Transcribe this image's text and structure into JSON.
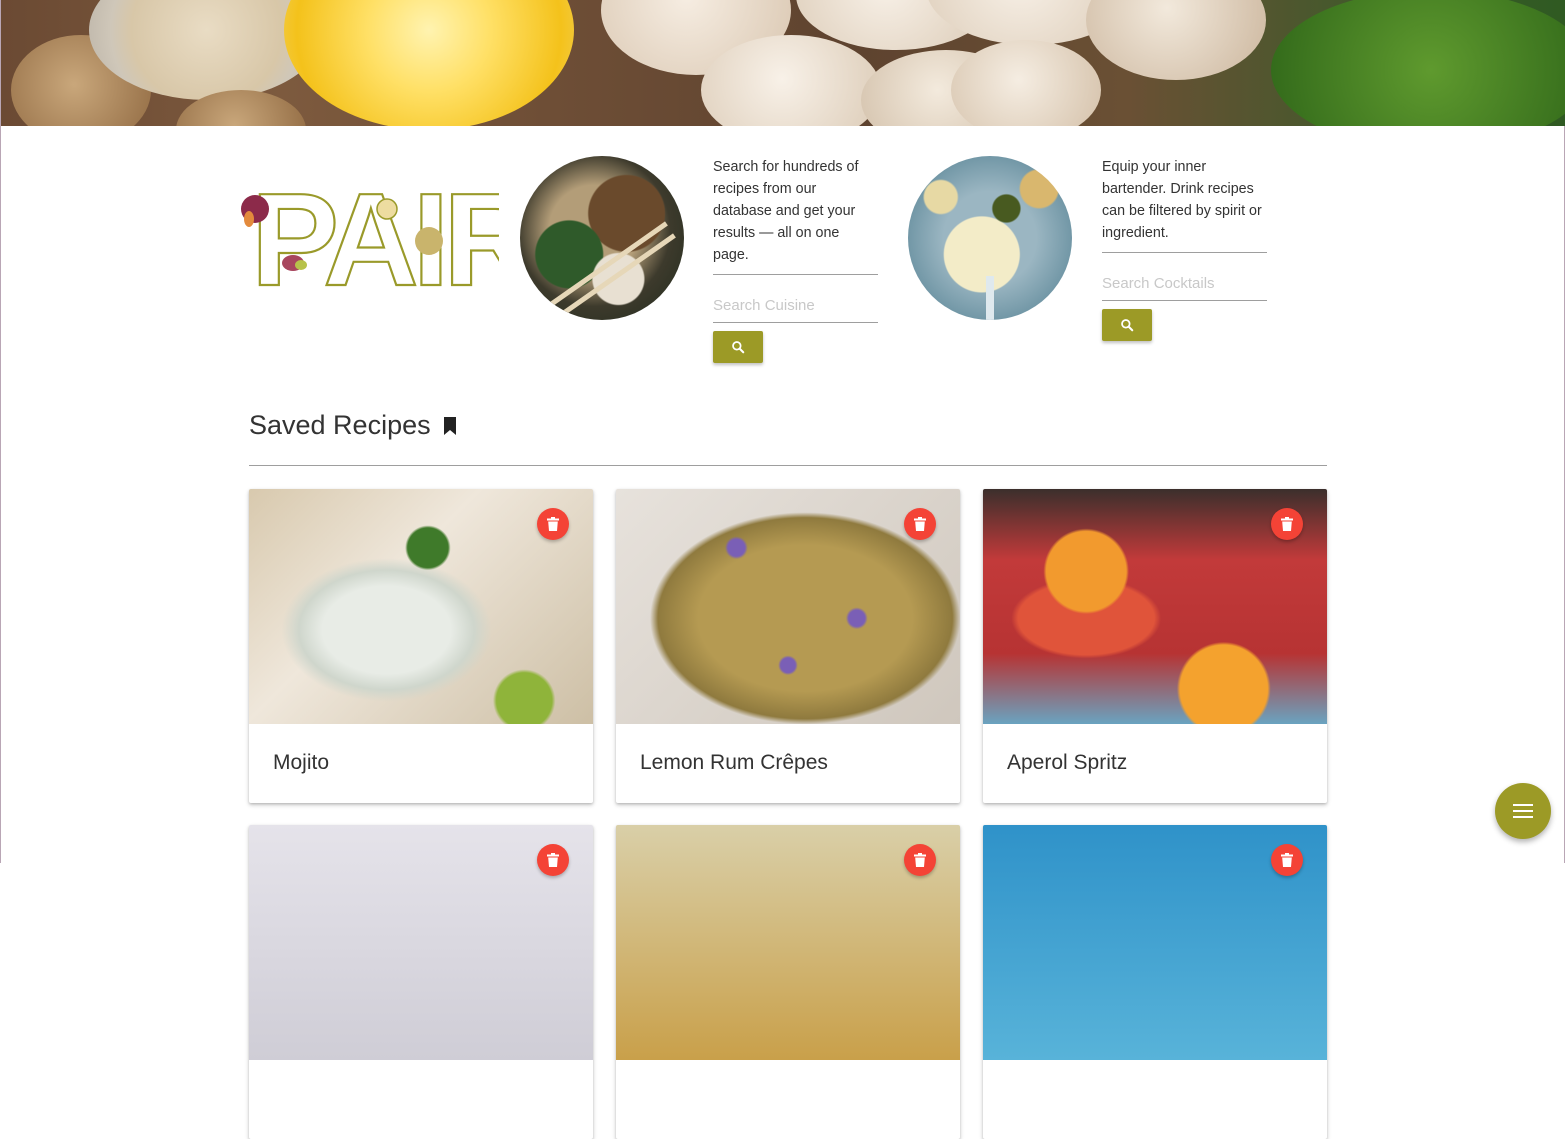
{
  "brand": {
    "logo_text": "PAIR",
    "primary_color": "#9c9a26",
    "danger_color": "#f44336"
  },
  "cuisine": {
    "description": "Search for hundreds of recipes from our database and get your results — all on one page.",
    "placeholder": "Search Cuisine",
    "button_icon": "search-icon"
  },
  "cocktails": {
    "description": "Equip your inner bartender. Drink recipes can be filtered by spirit or ingredient.",
    "placeholder": "Search Cocktails",
    "button_icon": "search-icon"
  },
  "saved": {
    "title": "Saved Recipes",
    "title_icon": "bookmark-icon",
    "cards": [
      {
        "title": "Mojito",
        "action_icon": "trash-icon"
      },
      {
        "title": "Lemon Rum Crêpes",
        "action_icon": "trash-icon"
      },
      {
        "title": "Aperol Spritz",
        "action_icon": "trash-icon"
      },
      {
        "title": "",
        "action_icon": "trash-icon"
      },
      {
        "title": "",
        "action_icon": "trash-icon"
      },
      {
        "title": "",
        "action_icon": "trash-icon"
      }
    ]
  },
  "fab": {
    "icon": "menu-icon"
  }
}
